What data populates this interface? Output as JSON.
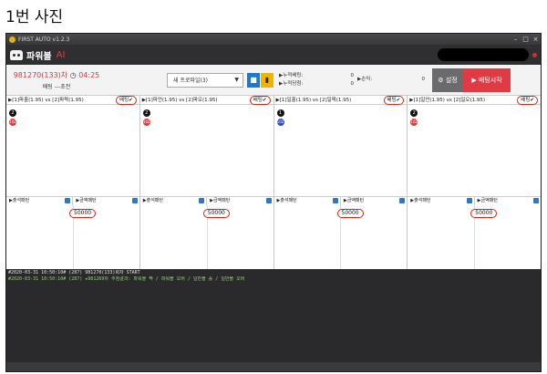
{
  "caption": "1번 사진",
  "window": {
    "title": "FIRST AUTO v1.2.3",
    "controls": [
      "–",
      "□",
      "×"
    ]
  },
  "app": {
    "name": "파워볼",
    "ai_label": "AI"
  },
  "status": {
    "round": "981270(133)차",
    "time": "04:25",
    "bet_line": "배팅 ---초전"
  },
  "profile_select": {
    "value": "새 프로파일(3)"
  },
  "stats_left": [
    {
      "label": "▶누적배팅:",
      "value": "0"
    },
    {
      "label": "▶누적당첨:",
      "value": "0"
    }
  ],
  "stats_right": [
    {
      "label": "▶손익:",
      "value": "0"
    }
  ],
  "buttons": {
    "settings": "설정",
    "start": "배팅시작"
  },
  "panels": [
    {
      "header": "▶[1]파홀(1.95) vs [2]파짝(1.95)",
      "bet": "배팅",
      "marker_num": "2",
      "marker_color": "#e23b3b",
      "marker_label": "102",
      "tab_left": "▶출석패턴",
      "tab_right": "▶금액패턴",
      "amount": "50000"
    },
    {
      "header": "▶[1]파언(1.95) vs [2]파오(1.95)",
      "bet": "배팅",
      "marker_num": "2",
      "marker_color": "#e23b3b",
      "marker_label": "102",
      "tab_left": "▶출석패턴",
      "tab_right": "▶금액패턴",
      "amount": "50000"
    },
    {
      "header": "▶[1]일홀(1.95) vs [2]일짝(1.95)",
      "bet": "배팅",
      "marker_num": "1",
      "marker_color": "#2a4fd6",
      "marker_label": "102",
      "tab_left": "▶출석패턴",
      "tab_right": "▶금액패턴",
      "amount": "50000"
    },
    {
      "header": "▶[1]일언(1.95) vs [2]일오(1.95)",
      "bet": "배팅",
      "marker_num": "2",
      "marker_color": "#e23b3b",
      "marker_label": "102",
      "tab_left": "▶출석패턴",
      "tab_right": "▶금액패턴",
      "amount": "50000"
    }
  ],
  "log": [
    "#2020-03-31 10:50:10# (287) 981270(133)회차 START",
    "#2020-03-31 10:50:10# (287) ★981269차 추첨결과: 파워볼 짝 / 파워볼 오버 / 일반볼 홀 / 일반볼 오버"
  ]
}
